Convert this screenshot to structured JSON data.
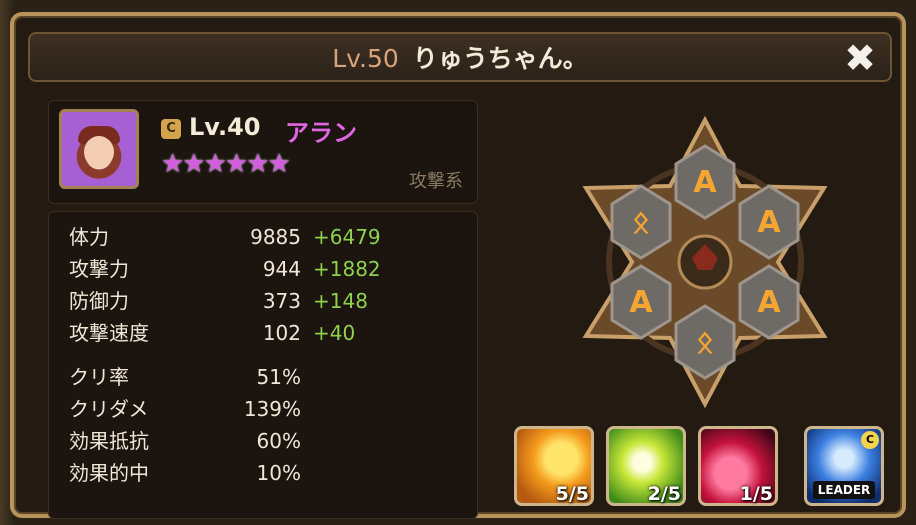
{
  "header": {
    "player_level": "Lv.50",
    "player_name": "りゅうちゃん。",
    "close_glyph": "✖"
  },
  "monster": {
    "icon_glyph": "C",
    "level": "Lv.40",
    "name": "アラン",
    "stars": "★★★★★★",
    "type": "攻撃系"
  },
  "stats": [
    {
      "label": "体力",
      "value": "9885",
      "bonus": "+6479"
    },
    {
      "label": "攻撃力",
      "value": "944",
      "bonus": "+1882"
    },
    {
      "label": "防御力",
      "value": "373",
      "bonus": "+148"
    },
    {
      "label": "攻撃速度",
      "value": "102",
      "bonus": "+40"
    },
    {
      "label": "クリ率",
      "value": "51%",
      "bonus": ""
    },
    {
      "label": "クリダメ",
      "value": "139%",
      "bonus": ""
    },
    {
      "label": "効果抵抗",
      "value": "60%",
      "bonus": ""
    },
    {
      "label": "効果的中",
      "value": "10%",
      "bonus": ""
    }
  ],
  "runes": {
    "slots": [
      "A",
      "A",
      "A",
      "A",
      "ᛟ",
      "ᛟ"
    ]
  },
  "skills": [
    {
      "level": "5/5"
    },
    {
      "level": "2/5"
    },
    {
      "level": "1/5"
    },
    {
      "level": "LEADER",
      "badge": "C"
    }
  ],
  "colors": {
    "frame": "#b8935b",
    "name_pink": "#e066e4",
    "bonus_green": "#8fd14e"
  }
}
